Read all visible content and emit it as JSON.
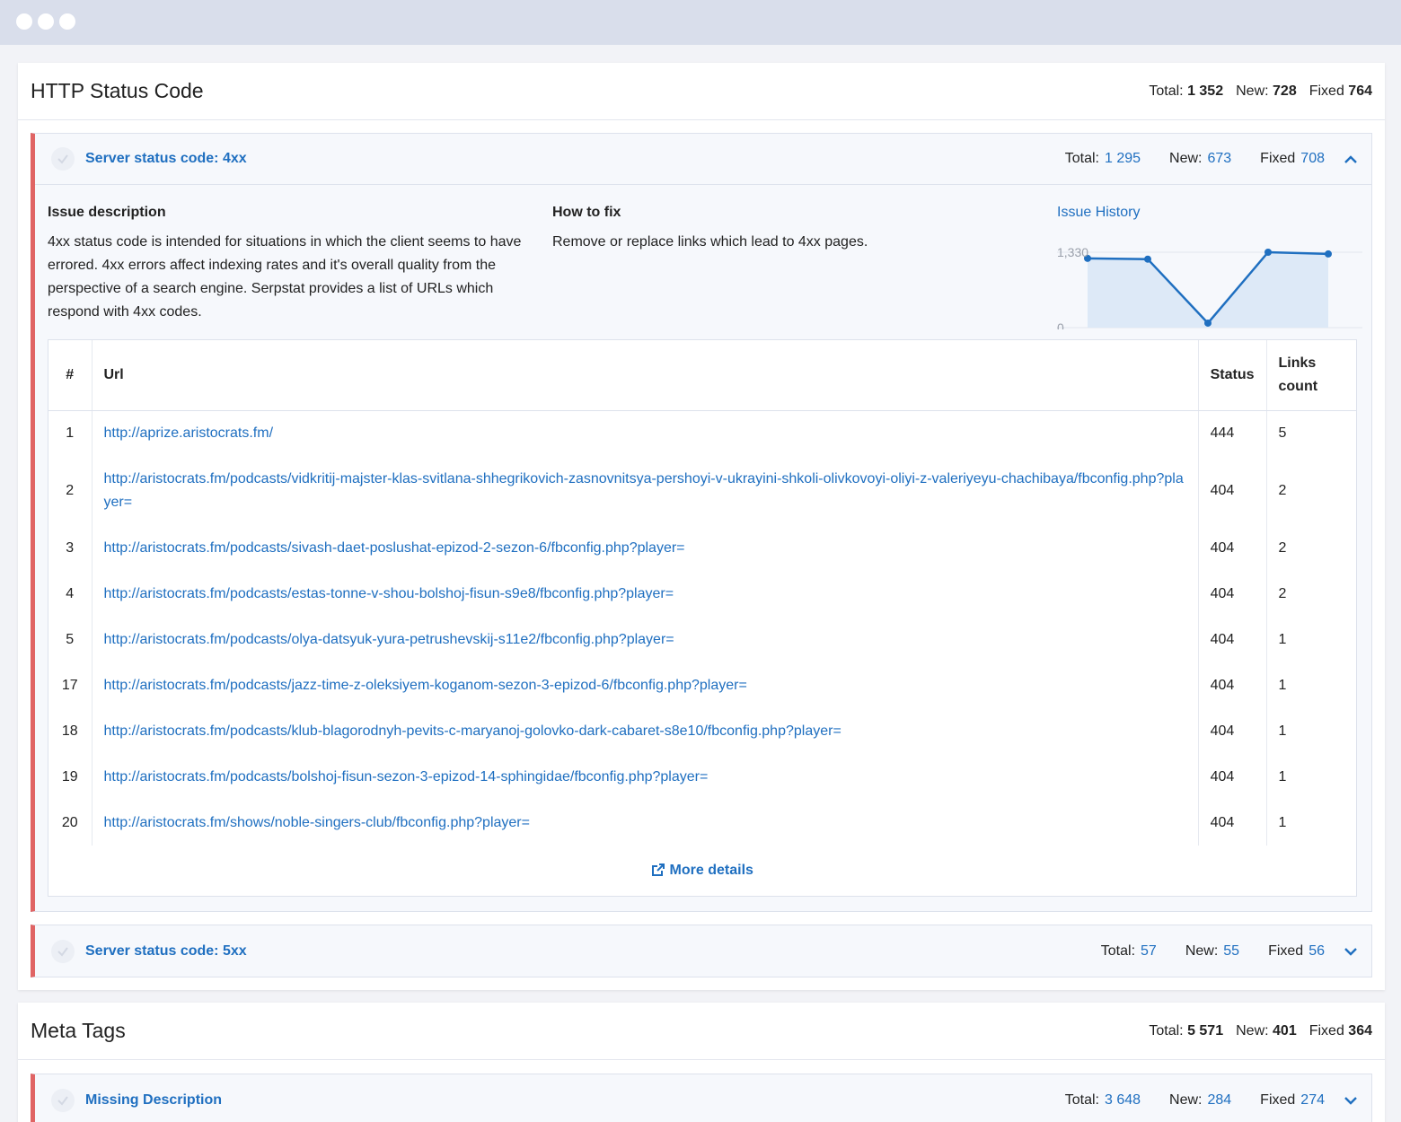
{
  "sections": {
    "http": {
      "title": "HTTP Status Code",
      "total_label": "Total:",
      "total": "1 352",
      "new_label": "New:",
      "new": "728",
      "fixed_label": "Fixed",
      "fixed": "764"
    },
    "meta": {
      "title": "Meta Tags",
      "total_label": "Total:",
      "total": "5 571",
      "new_label": "New:",
      "new": "401",
      "fixed_label": "Fixed",
      "fixed": "364"
    }
  },
  "issues": {
    "s4xx": {
      "title": "Server status code: 4xx",
      "total_label": "Total:",
      "total": "1 295",
      "new_label": "New:",
      "new": "673",
      "fixed_label": "Fixed",
      "fixed": "708"
    },
    "s5xx": {
      "title": "Server status code: 5xx",
      "total_label": "Total:",
      "total": "57",
      "new_label": "New:",
      "new": "55",
      "fixed_label": "Fixed",
      "fixed": "56"
    },
    "missing_desc": {
      "title": "Missing Description",
      "total_label": "Total:",
      "total": "3 648",
      "new_label": "New:",
      "new": "284",
      "fixed_label": "Fixed",
      "fixed": "274"
    }
  },
  "details": {
    "description_title": "Issue description",
    "description_text": "4xx status code is intended for situations in which the client seems to have errored. 4xx errors affect indexing rates and it's overall quality from the perspective of a search engine. Serpstat provides a list of URLs which respond with 4xx codes.",
    "fix_title": "How to fix",
    "fix_text": "Remove or replace links which lead to 4xx pages.",
    "history_title": "Issue History",
    "more_details": "More details"
  },
  "chart_data": {
    "type": "area",
    "title": "Issue History",
    "y_ticks": [
      "1,330",
      "0"
    ],
    "ylim": [
      0,
      1330
    ],
    "values": [
      1222,
      1208,
      80,
      1330,
      1300
    ]
  },
  "table": {
    "headers": {
      "num": "#",
      "url": "Url",
      "status": "Status",
      "links": "Links count"
    },
    "rows": [
      {
        "num": "1",
        "url": "http://aprize.aristocrats.fm/",
        "status": "444",
        "links": "5"
      },
      {
        "num": "2",
        "url": "http://aristocrats.fm/podcasts/vidkritij-majster-klas-svitlana-shhegrikovich-zasnovnitsya-pershoyi-v-ukrayini-shkoli-olivkovoyi-oliyi-z-valeriyeyu-chachibaya/fbconfig.php?player=",
        "status": "404",
        "links": "2"
      },
      {
        "num": "3",
        "url": "http://aristocrats.fm/podcasts/sivash-daet-poslushat-epizod-2-sezon-6/fbconfig.php?player=",
        "status": "404",
        "links": "2"
      },
      {
        "num": "4",
        "url": "http://aristocrats.fm/podcasts/estas-tonne-v-shou-bolshoj-fisun-s9e8/fbconfig.php?player=",
        "status": "404",
        "links": "2"
      },
      {
        "num": "5",
        "url": "http://aristocrats.fm/podcasts/olya-datsyuk-yura-petrushevskij-s11e2/fbconfig.php?player=",
        "status": "404",
        "links": "1"
      },
      {
        "num": "17",
        "url": "http://aristocrats.fm/podcasts/jazz-time-z-oleksiyem-koganom-sezon-3-epizod-6/fbconfig.php?player=",
        "status": "404",
        "links": "1"
      },
      {
        "num": "18",
        "url": "http://aristocrats.fm/podcasts/klub-blagorodnyh-pevits-c-maryanoj-golovko-dark-cabaret-s8e10/fbconfig.php?player=",
        "status": "404",
        "links": "1"
      },
      {
        "num": "19",
        "url": "http://aristocrats.fm/podcasts/bolshoj-fisun-sezon-3-epizod-14-sphingidae/fbconfig.php?player=",
        "status": "404",
        "links": "1"
      },
      {
        "num": "20",
        "url": "http://aristocrats.fm/shows/noble-singers-club/fbconfig.php?player=",
        "status": "404",
        "links": "1"
      }
    ]
  }
}
